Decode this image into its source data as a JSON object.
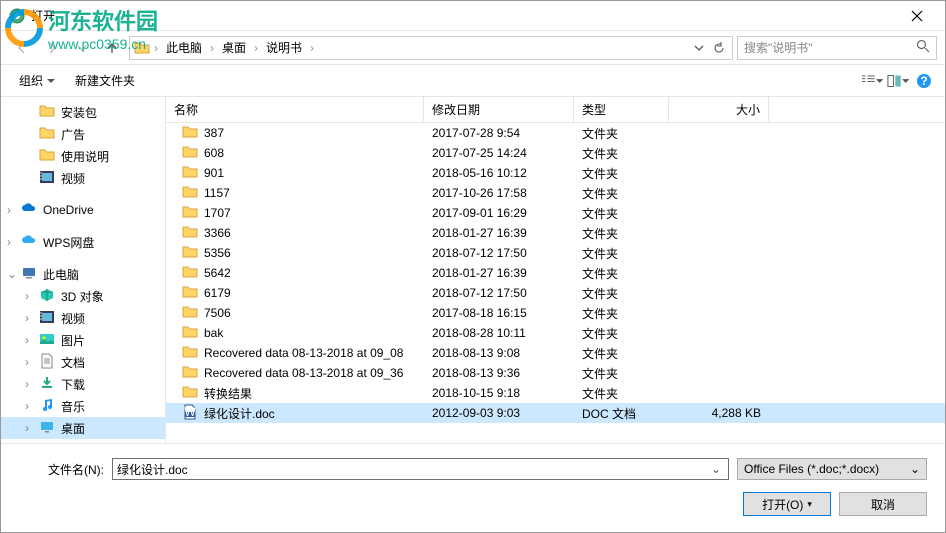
{
  "window": {
    "title": "打开"
  },
  "watermark": {
    "name": "河东软件园",
    "url": "www.pc0359.cn"
  },
  "breadcrumb": {
    "items": [
      "此电脑",
      "桌面",
      "说明书"
    ]
  },
  "search": {
    "placeholder": "搜索\"说明书\""
  },
  "toolbar": {
    "organize": "组织",
    "newfolder": "新建文件夹"
  },
  "tree": {
    "items": [
      {
        "label": "安装包",
        "icon": "folder",
        "level": 2
      },
      {
        "label": "广告",
        "icon": "folder",
        "level": 2
      },
      {
        "label": "使用说明",
        "icon": "folder",
        "level": 2
      },
      {
        "label": "视频",
        "icon": "video",
        "level": 2
      },
      {
        "label": "OneDrive",
        "icon": "onedrive",
        "level": 1,
        "exp": ">"
      },
      {
        "label": "WPS网盘",
        "icon": "wps",
        "level": 1,
        "exp": ">"
      },
      {
        "label": "此电脑",
        "icon": "pc",
        "level": 1,
        "exp": "v"
      },
      {
        "label": "3D 对象",
        "icon": "3d",
        "level": 2,
        "exp": ">"
      },
      {
        "label": "视频",
        "icon": "video",
        "level": 2,
        "exp": ">"
      },
      {
        "label": "图片",
        "icon": "pictures",
        "level": 2,
        "exp": ">"
      },
      {
        "label": "文档",
        "icon": "documents",
        "level": 2,
        "exp": ">"
      },
      {
        "label": "下载",
        "icon": "downloads",
        "level": 2,
        "exp": ">"
      },
      {
        "label": "音乐",
        "icon": "music",
        "level": 2,
        "exp": ">"
      },
      {
        "label": "桌面",
        "icon": "desktop",
        "level": 2,
        "exp": ">",
        "selected": true
      }
    ]
  },
  "columns": {
    "name": "名称",
    "date": "修改日期",
    "type": "类型",
    "size": "大小"
  },
  "files": [
    {
      "name": "387",
      "date": "2017-07-28 9:54",
      "type": "文件夹",
      "size": "",
      "icon": "folder"
    },
    {
      "name": "608",
      "date": "2017-07-25 14:24",
      "type": "文件夹",
      "size": "",
      "icon": "folder"
    },
    {
      "name": "901",
      "date": "2018-05-16 10:12",
      "type": "文件夹",
      "size": "",
      "icon": "folder"
    },
    {
      "name": "1157",
      "date": "2017-10-26 17:58",
      "type": "文件夹",
      "size": "",
      "icon": "folder"
    },
    {
      "name": "1707",
      "date": "2017-09-01 16:29",
      "type": "文件夹",
      "size": "",
      "icon": "folder"
    },
    {
      "name": "3366",
      "date": "2018-01-27 16:39",
      "type": "文件夹",
      "size": "",
      "icon": "folder"
    },
    {
      "name": "5356",
      "date": "2018-07-12 17:50",
      "type": "文件夹",
      "size": "",
      "icon": "folder"
    },
    {
      "name": "5642",
      "date": "2018-01-27 16:39",
      "type": "文件夹",
      "size": "",
      "icon": "folder"
    },
    {
      "name": "6179",
      "date": "2018-07-12 17:50",
      "type": "文件夹",
      "size": "",
      "icon": "folder"
    },
    {
      "name": "7506",
      "date": "2017-08-18 16:15",
      "type": "文件夹",
      "size": "",
      "icon": "folder"
    },
    {
      "name": "bak",
      "date": "2018-08-28 10:11",
      "type": "文件夹",
      "size": "",
      "icon": "folder"
    },
    {
      "name": "Recovered data 08-13-2018 at 09_08",
      "date": "2018-08-13 9:08",
      "type": "文件夹",
      "size": "",
      "icon": "folder"
    },
    {
      "name": "Recovered data 08-13-2018 at 09_36",
      "date": "2018-08-13 9:36",
      "type": "文件夹",
      "size": "",
      "icon": "folder"
    },
    {
      "name": "转换结果",
      "date": "2018-10-15 9:18",
      "type": "文件夹",
      "size": "",
      "icon": "folder"
    },
    {
      "name": "绿化设计.doc",
      "date": "2012-09-03 9:03",
      "type": "DOC 文档",
      "size": "4,288 KB",
      "icon": "doc",
      "selected": true
    }
  ],
  "footer": {
    "filename_label": "文件名(N):",
    "filename_value": "绿化设计.doc",
    "filter": "Office Files (*.doc;*.docx)",
    "open": "打开(O)",
    "cancel": "取消"
  }
}
